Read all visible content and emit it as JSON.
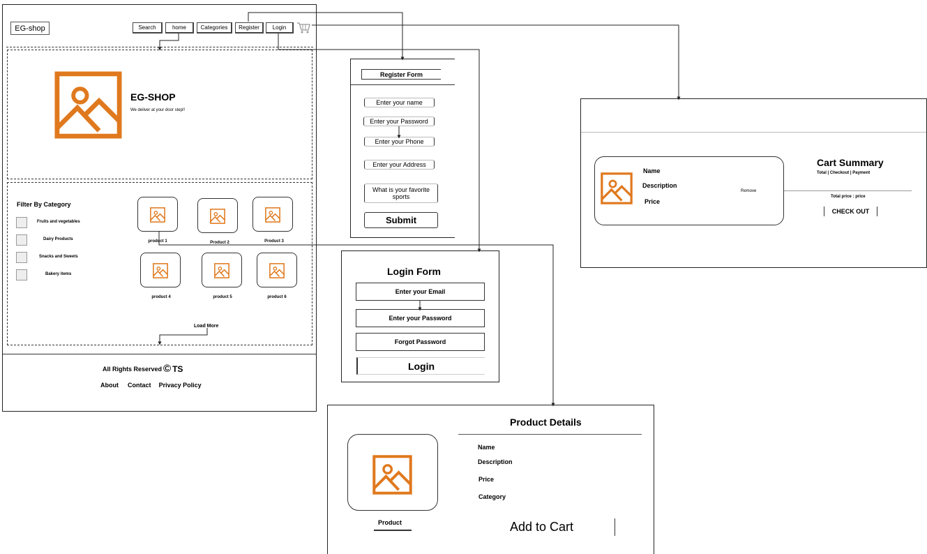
{
  "home": {
    "logo": "EG-shop",
    "nav": [
      "Search",
      "home",
      "Categories",
      "Register",
      "Login"
    ],
    "hero_title": "EG-SHOP",
    "hero_tagline": "We deliver at your door step!!",
    "filter_title": "Filter By Category",
    "categories": [
      "Fruits and vegetables",
      "Dairy Products",
      "Snacks and Sweets",
      "Bakery items"
    ],
    "products": [
      "product 1",
      "Product 2",
      "Product 3",
      "product 4",
      "product 5",
      "product 6"
    ],
    "load_more": "Load More",
    "footer_rights": "All Rights Reserved",
    "footer_copy": "©",
    "footer_ts": "TS",
    "footer_links": [
      "About",
      "Contact",
      "Privacy Policy"
    ]
  },
  "register": {
    "title": "Register Form",
    "fields": [
      "Enter your name",
      "Enter your Password",
      "Enter your Phone",
      "Enter your Address",
      "What is your  favorite sports"
    ],
    "submit": "Submit"
  },
  "login": {
    "title": "Login Form",
    "fields": [
      "Enter your Email",
      "Enter your Password",
      "Forgot Password"
    ],
    "login_button": "Login"
  },
  "cart": {
    "labels": [
      "Name",
      "Description",
      "Price"
    ],
    "remove": "Remove",
    "summary_title": "Cart Summary",
    "summary_sub": "Total | Checkout | Payment",
    "total": "Total price : price",
    "checkout": "CHECK OUT"
  },
  "details": {
    "title": "Product Details",
    "labels": [
      "Name",
      "Description",
      "Price",
      "Category"
    ],
    "product_label": "Product",
    "add_to_cart": "Add to Cart"
  },
  "colors": {
    "accent": "#E0791E",
    "line": "#222222"
  }
}
